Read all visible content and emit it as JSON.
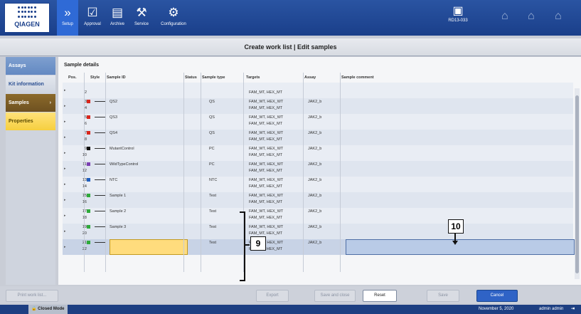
{
  "app": {
    "brand": "QIAGEN",
    "instrument": "RD13-033"
  },
  "nav": [
    {
      "label": "Setup",
      "glyph": "»",
      "icon": "setup-icon"
    },
    {
      "label": "Approval",
      "glyph": "☑",
      "icon": "approval-icon"
    },
    {
      "label": "Archive",
      "glyph": "▤",
      "icon": "archive-icon"
    },
    {
      "label": "Service",
      "glyph": "⚒",
      "icon": "service-icon"
    },
    {
      "label": "Configuration",
      "glyph": "⚙",
      "icon": "configuration-icon"
    }
  ],
  "title": "Create work list | Edit samples",
  "sidebar": [
    "Assays",
    "Kit information",
    "Samples",
    "Properties"
  ],
  "section_title": "Sample details",
  "columns": [
    "Pos.",
    "Style",
    "Sample ID",
    "Status",
    "Sample type",
    "Targets",
    "Assay",
    "Sample comment"
  ],
  "rows": [
    {
      "pos_a": "",
      "pos_b": "2",
      "color": "",
      "sample_id": "",
      "type": "",
      "targets_a": "",
      "targets_b": "FAM_MT, HEX_MT",
      "assay": ""
    },
    {
      "pos_a": "3",
      "pos_b": "4",
      "color": "#d9261c",
      "sample_id": "QS2",
      "type": "QS",
      "targets_a": "FAM_WT, HEX_WT",
      "targets_b": "FAM_MT, HEX_MT",
      "assay": "JAK2_b"
    },
    {
      "pos_a": "5",
      "pos_b": "6",
      "color": "#d9261c",
      "sample_id": "QS3",
      "type": "QS",
      "targets_a": "FAM_WT, HEX_WT",
      "targets_b": "FAM_MT, HEX_MT",
      "assay": "JAK2_b"
    },
    {
      "pos_a": "7",
      "pos_b": "8",
      "color": "#d9261c",
      "sample_id": "QS4",
      "type": "QS",
      "targets_a": "FAM_WT, HEX_WT",
      "targets_b": "FAM_MT, HEX_MT",
      "assay": "JAK2_b"
    },
    {
      "pos_a": "9",
      "pos_b": "10",
      "color": "#111111",
      "sample_id": "MutantControl",
      "type": "PC",
      "targets_a": "FAM_WT, HEX_WT",
      "targets_b": "FAM_MT, HEX_MT",
      "assay": "JAK2_b"
    },
    {
      "pos_a": "11",
      "pos_b": "12",
      "color": "#7b3fb3",
      "sample_id": "WildTypeControl",
      "type": "PC",
      "targets_a": "FAM_WT, HEX_WT",
      "targets_b": "FAM_MT, HEX_MT",
      "assay": "JAK2_b"
    },
    {
      "pos_a": "13",
      "pos_b": "14",
      "color": "#1f5fbf",
      "sample_id": "NTC",
      "type": "NTC",
      "targets_a": "FAM_WT, HEX_WT",
      "targets_b": "FAM_MT, HEX_MT",
      "assay": "JAK2_b"
    },
    {
      "pos_a": "15",
      "pos_b": "16",
      "color": "#2eaa3a",
      "sample_id": "Sample 1",
      "type": "Test",
      "targets_a": "FAM_WT, HEX_WT",
      "targets_b": "FAM_MT, HEX_MT",
      "assay": "JAK2_b"
    },
    {
      "pos_a": "17",
      "pos_b": "18",
      "color": "#2eaa3a",
      "sample_id": "Sample 2",
      "type": "Test",
      "targets_a": "FAM_WT, HEX_WT",
      "targets_b": "FAM_MT, HEX_MT",
      "assay": "JAK2_b"
    },
    {
      "pos_a": "19",
      "pos_b": "20",
      "color": "#2eaa3a",
      "sample_id": "Sample 3",
      "type": "Test",
      "targets_a": "FAM_WT, HEX_WT",
      "targets_b": "FAM_MT, HEX_MT",
      "assay": "JAK2_b"
    },
    {
      "pos_a": "21",
      "pos_b": "22",
      "color": "#2eaa3a",
      "sample_id": "",
      "type": "Test",
      "targets_a": "FAM_WT, HEX_WT",
      "targets_b": "FAM_MT, HEX_MT",
      "assay": "JAK2_b"
    }
  ],
  "callouts": {
    "bracket": "9",
    "comment": "10"
  },
  "buttons": {
    "print": "Print work list...",
    "export": "Export",
    "save_close": "Save and close",
    "reset": "Reset",
    "save": "Save",
    "cancel": "Cancel"
  },
  "status": {
    "mode": "Closed Mode",
    "date": "November 5, 2020",
    "user": "admin admin"
  }
}
